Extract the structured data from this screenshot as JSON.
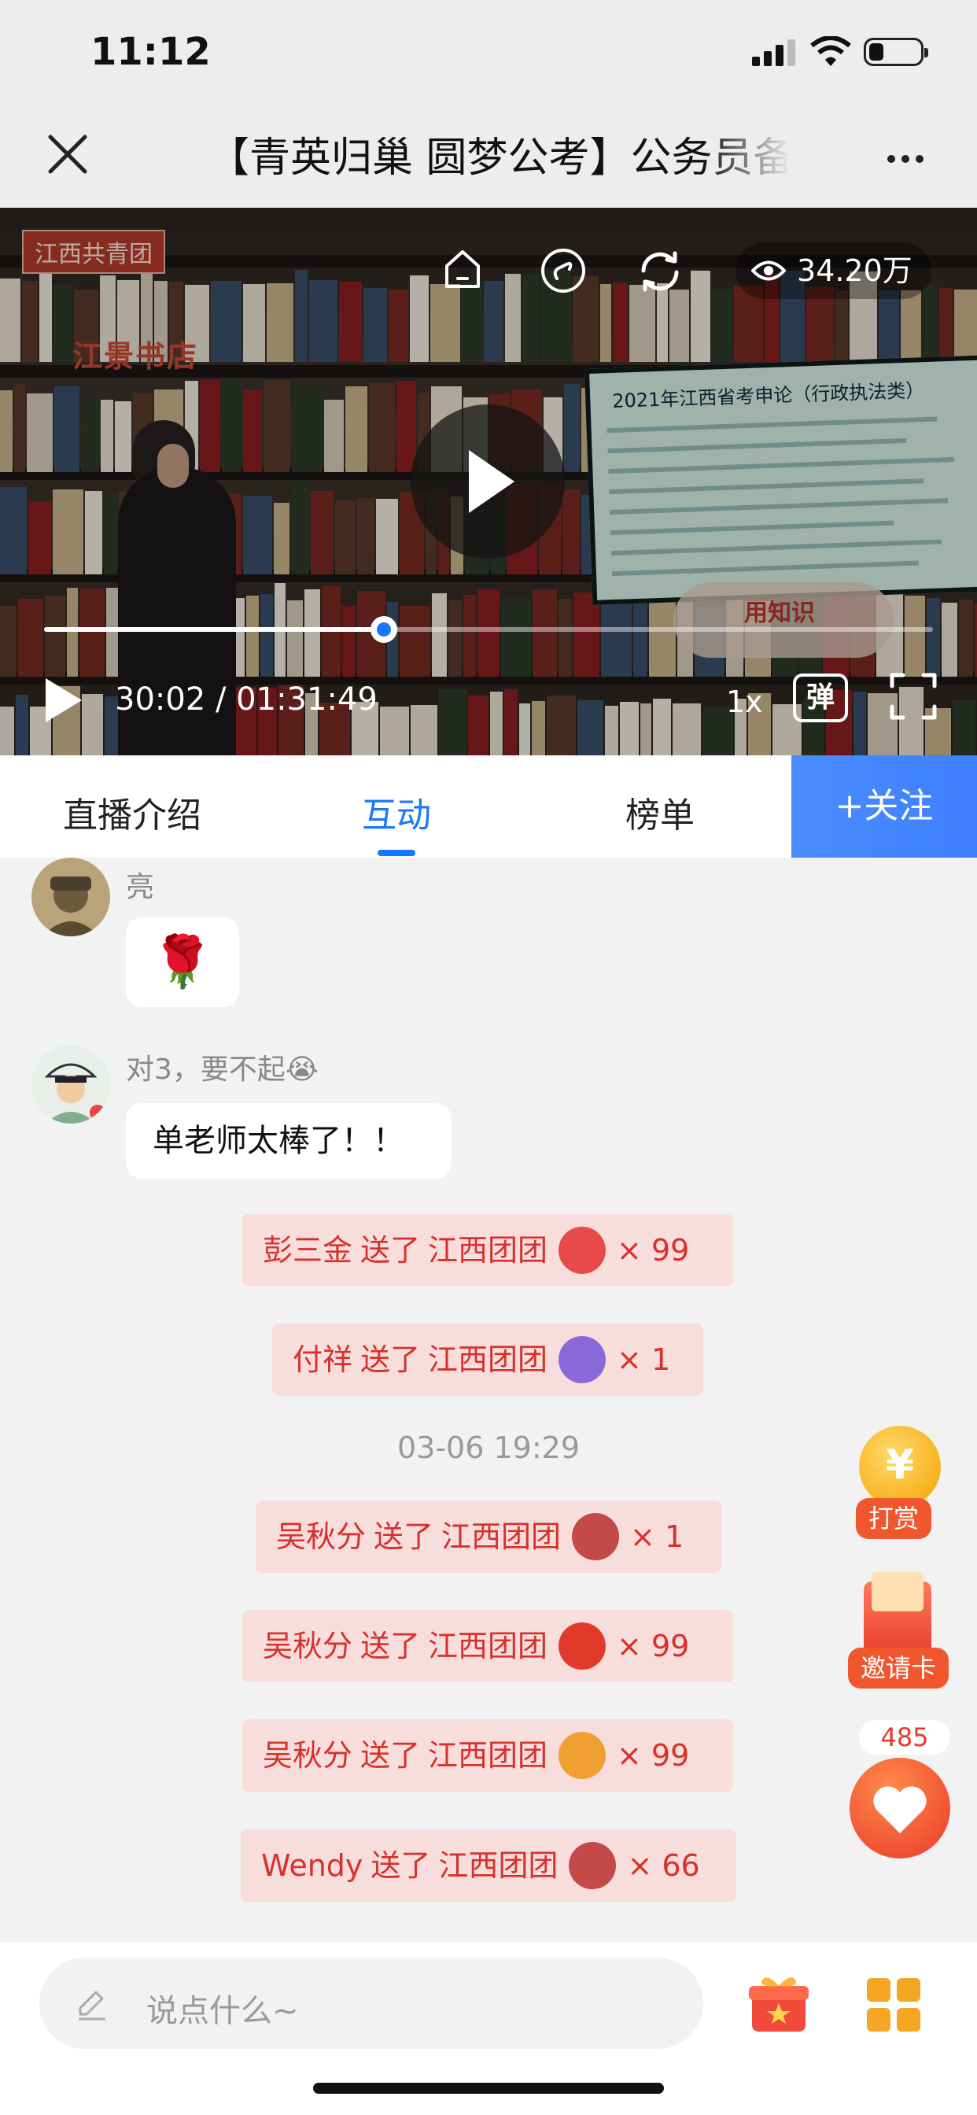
{
  "status_bar": {
    "time": "11:12"
  },
  "header": {
    "title": "【青英归巢 圆梦公考】公务员备考"
  },
  "video": {
    "scene_signs": [
      "江西共青团",
      "江景书店"
    ],
    "screen_title": "2021年江西省考申论（行政执法类）",
    "banner_text": "用知识",
    "views": "34.20万",
    "elapsed": "30:02 / 01:31:49",
    "progress": 0.382,
    "speed": "1x",
    "danmu_label": "弹"
  },
  "tabs": {
    "items": [
      "直播介绍",
      "互动",
      "榜单"
    ],
    "active": "互动",
    "follow": "+关注"
  },
  "chat": [
    {
      "nick": "亮",
      "content": "🌹"
    },
    {
      "nick": "对3，要不起😭",
      "content": "单老师太棒了！！"
    }
  ],
  "gifts": [
    {
      "user": "彭三金",
      "verb": "送了",
      "to": "江西团团",
      "count": "× 99",
      "color": "#e84a4a"
    },
    {
      "user": "付祥",
      "verb": "送了",
      "to": "江西团团",
      "count": "× 1",
      "color": "#8a6ad8"
    },
    {
      "user": "吴秋分",
      "verb": "送了",
      "to": "江西团团",
      "count": "× 1",
      "color": "#c44a4a"
    },
    {
      "user": "吴秋分",
      "verb": "送了",
      "to": "江西团团",
      "count": "× 99",
      "color": "#e23a2a"
    },
    {
      "user": "吴秋分",
      "verb": "送了",
      "to": "江西团团",
      "count": "× 99",
      "color": "#f0a030"
    },
    {
      "user": "Wendy",
      "verb": "送了",
      "to": "江西团团",
      "count": "× 66",
      "color": "#c44a4a"
    }
  ],
  "timestamp": "03-06 19:29",
  "floating": {
    "reward": "打赏",
    "invite": "邀请卡",
    "likes": "485"
  },
  "input": {
    "placeholder": "说点什么~"
  },
  "colors": {
    "accent": "#1677ff",
    "gift_text": "#d8302a",
    "gift_bg": "#f7dedd"
  }
}
